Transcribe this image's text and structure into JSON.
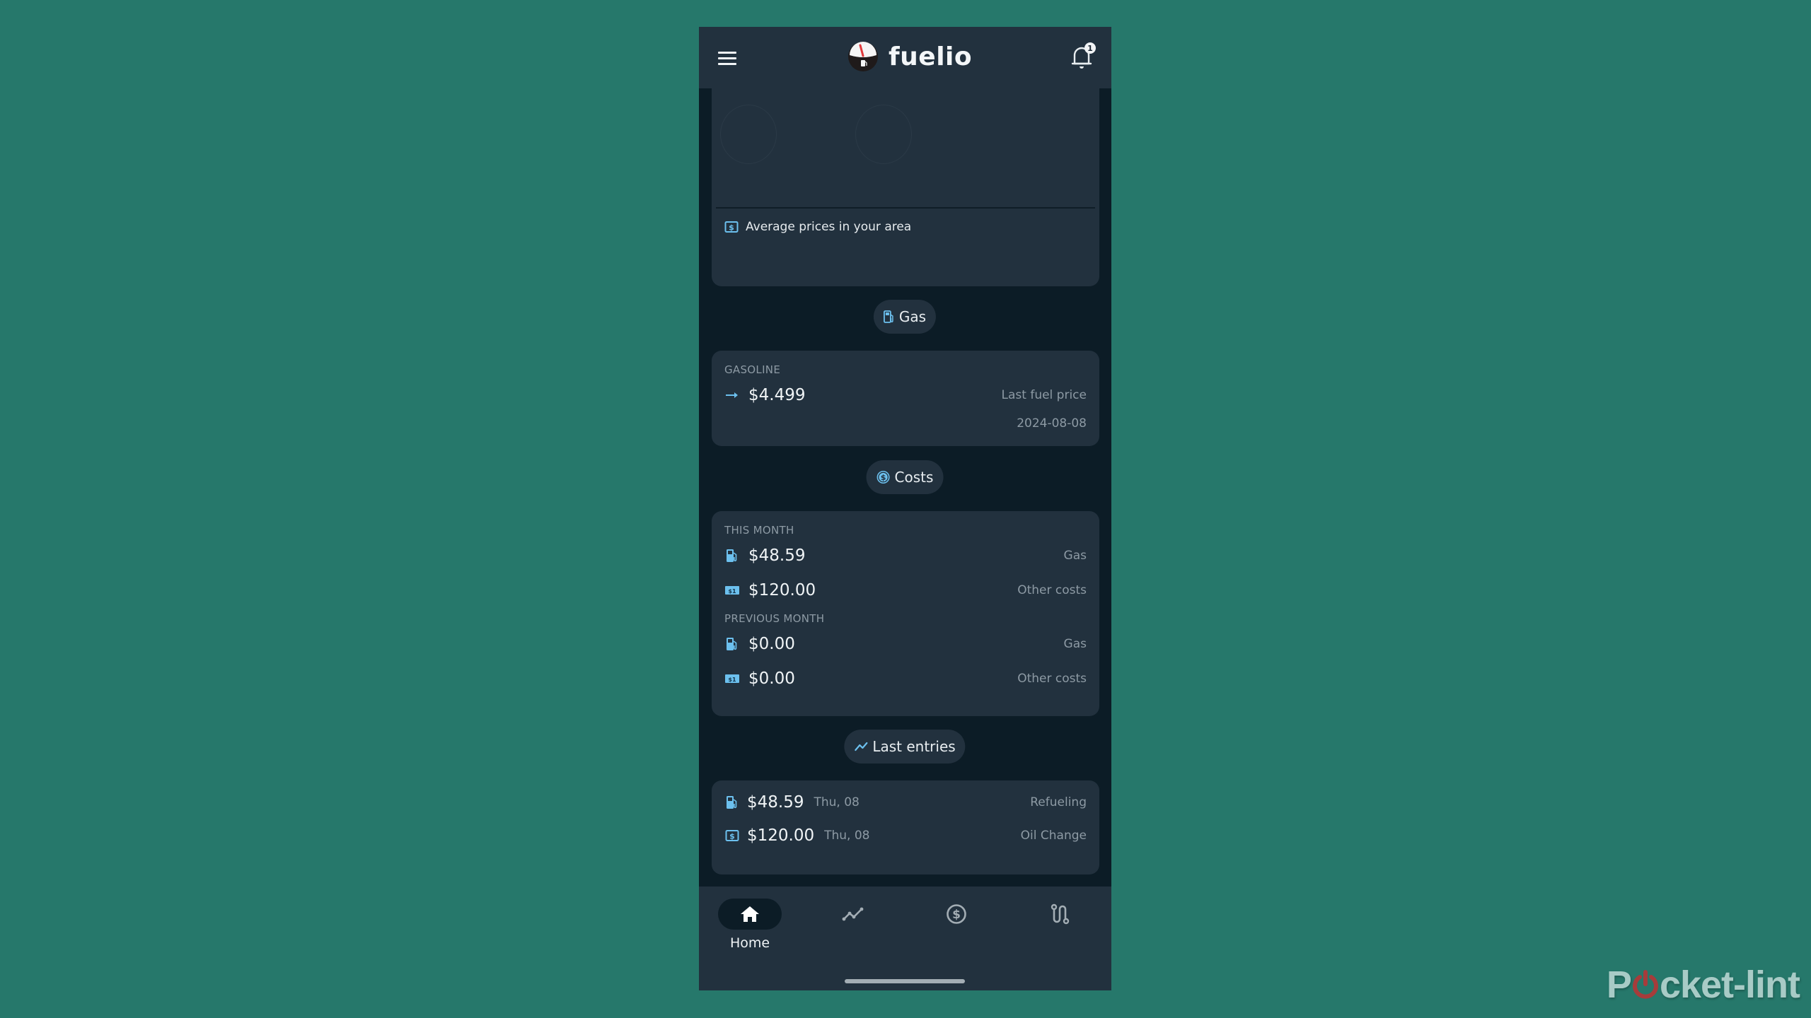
{
  "header": {
    "app_name": "fuelio",
    "notification_count": "1"
  },
  "top_card": {
    "average_prices_label": "Average prices in your area"
  },
  "gas_section": {
    "chip_label": "Gas",
    "fuel_type": "GASOLINE",
    "price": "$4.499",
    "price_trend": "flat",
    "last_price_label": "Last fuel price",
    "last_price_date": "2024-08-08"
  },
  "costs_section": {
    "chip_label": "Costs",
    "this_month": {
      "label": "THIS MONTH",
      "gas_amount": "$48.59",
      "gas_label": "Gas",
      "other_amount": "$120.00",
      "other_label": "Other costs"
    },
    "previous_month": {
      "label": "PREVIOUS MONTH",
      "gas_amount": "$0.00",
      "gas_label": "Gas",
      "other_amount": "$0.00",
      "other_label": "Other costs"
    }
  },
  "last_entries": {
    "chip_label": "Last entries",
    "items": [
      {
        "icon": "fuel-pump-icon",
        "amount": "$48.59",
        "date": "Thu, 08",
        "type": "Refueling"
      },
      {
        "icon": "cash-icon",
        "amount": "$120.00",
        "date": "Thu, 08",
        "type": "Oil Change"
      }
    ]
  },
  "bottom_nav": {
    "items": [
      {
        "icon": "home-icon",
        "label": "Home",
        "active": true
      },
      {
        "icon": "stats-icon",
        "label": "",
        "active": false
      },
      {
        "icon": "costs-icon",
        "label": "",
        "active": false
      },
      {
        "icon": "route-icon",
        "label": "",
        "active": false
      }
    ]
  },
  "watermark": {
    "text_before": "P",
    "text_after": "cket-lint"
  },
  "colors": {
    "background": "#26786b",
    "surface": "#22313e",
    "app_background": "#0c1c26",
    "accent": "#6cc0ee",
    "muted_text": "#8d9aa4"
  }
}
